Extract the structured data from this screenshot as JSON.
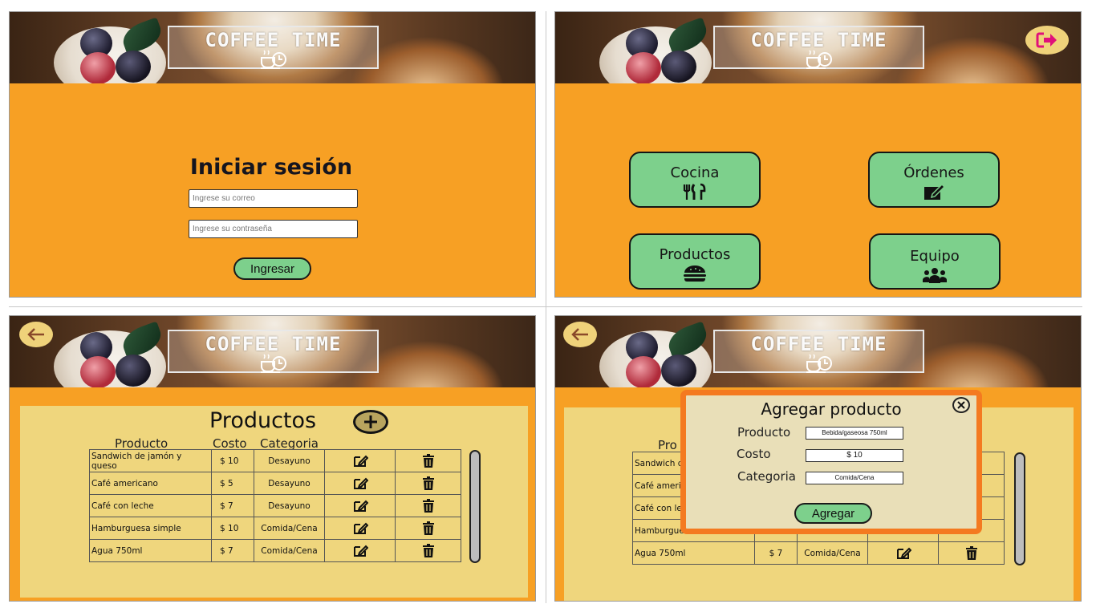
{
  "app": {
    "logo_text": "COFFEE TIME",
    "logo_icon": "coffee-cup-clock-icon"
  },
  "login": {
    "title": "Iniciar sesión",
    "email_placeholder": "Ingrese su correo",
    "password_placeholder": "Ingrese su contraseña",
    "submit_label": "Ingresar"
  },
  "menu": {
    "logout_icon": "sign-out-icon",
    "tiles": [
      {
        "label": "Cocina",
        "icon": "utensils-icon"
      },
      {
        "label": "Órdenes",
        "icon": "edit-order-icon"
      },
      {
        "label": "Productos",
        "icon": "burger-icon"
      },
      {
        "label": "Equipo",
        "icon": "users-icon"
      }
    ]
  },
  "products": {
    "back_icon": "arrow-left-icon",
    "title": "Productos",
    "add_icon": "plus-circle-icon",
    "columns": [
      "Producto",
      "Costo",
      "Categoria"
    ],
    "rows": [
      {
        "name": "Sandwich de jamón y queso",
        "cost": "$ 10",
        "category": "Desayuno"
      },
      {
        "name": "Café americano",
        "cost": "$ 5",
        "category": "Desayuno"
      },
      {
        "name": "Café con leche",
        "cost": "$ 7",
        "category": "Desayuno"
      },
      {
        "name": "Hamburguesa simple",
        "cost": "$ 10",
        "category": "Comida/Cena"
      },
      {
        "name": "Agua 750ml",
        "cost": "$ 7",
        "category": "Comida/Cena"
      }
    ]
  },
  "products_behind_modal": {
    "col_fragment": "Pro",
    "row_fragments": [
      "Sandwich d",
      "Café ameri",
      "Café con le",
      "Hamburgue"
    ],
    "last_row": {
      "name": "Agua 750ml",
      "cost": "$ 7",
      "category": "Comida/Cena"
    }
  },
  "modal": {
    "title": "Agregar producto",
    "close_icon": "close-circle-icon",
    "fields": [
      {
        "label": "Producto",
        "value": "Bebida/gaseosa 750ml"
      },
      {
        "label": "Costo",
        "value": "$ 10"
      },
      {
        "label": "Categoria",
        "value": "Comida/Cena"
      }
    ],
    "submit_label": "Agregar"
  },
  "colors": {
    "background_orange": "#f7a024",
    "tile_green": "#7dd08c",
    "panel_yellow": "#efd67d",
    "modal_border": "#f47a20",
    "logout_pink": "#e0107a"
  }
}
